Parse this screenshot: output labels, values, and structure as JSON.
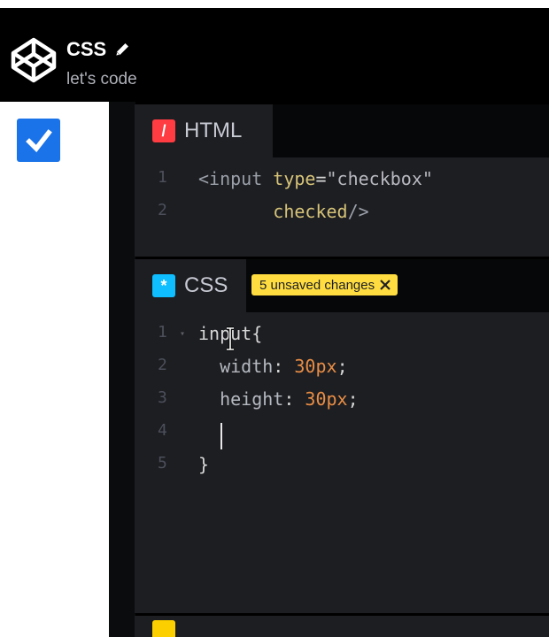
{
  "header": {
    "title": "CSS",
    "subtitle": "let's code"
  },
  "preview": {
    "checked": true
  },
  "panes": {
    "html": {
      "icon": "/",
      "label": "HTML",
      "lines": [
        {
          "num": "1",
          "parts": [
            [
              "tag",
              "<input "
            ],
            [
              "attr",
              "type"
            ],
            [
              "punc",
              "="
            ],
            [
              "str",
              "\"checkbox\""
            ]
          ]
        },
        {
          "num": "2",
          "parts": [
            [
              "attr",
              "       checked"
            ],
            [
              "tag",
              "/>"
            ]
          ]
        }
      ]
    },
    "css": {
      "icon": "*",
      "label": "CSS",
      "badge": "5 unsaved changes",
      "lines": [
        {
          "num": "1",
          "parts": [
            [
              "punc",
              "input{"
            ]
          ]
        },
        {
          "num": "2",
          "parts": [
            [
              "prop",
              "  width"
            ],
            [
              "punc",
              ": "
            ],
            [
              "num",
              "30px"
            ],
            [
              "punc",
              ";"
            ]
          ]
        },
        {
          "num": "3",
          "parts": [
            [
              "prop",
              "  height"
            ],
            [
              "punc",
              ": "
            ],
            [
              "num",
              "30px"
            ],
            [
              "punc",
              ";"
            ]
          ]
        },
        {
          "num": "4",
          "parts": []
        },
        {
          "num": "5",
          "parts": [
            [
              "punc",
              "}"
            ]
          ]
        }
      ]
    },
    "js": {
      "icon": ""
    }
  },
  "colors": {
    "html_icon": "#ff3c41",
    "css_icon": "#0ebeff",
    "js_icon": "#fcd000",
    "badge": "#ffdd40",
    "checkbox": "#1a73e8"
  },
  "icons": {
    "logo": "codepen-logo-icon",
    "edit": "pencil-icon",
    "badge_close": "close-icon",
    "fold": "fold-arrow-icon"
  }
}
